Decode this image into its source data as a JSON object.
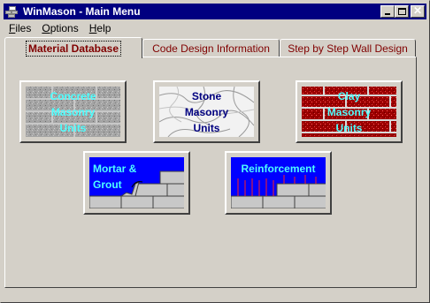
{
  "window": {
    "title": "WinMason - Main Menu"
  },
  "menu": [
    {
      "label": "Files"
    },
    {
      "label": "Options"
    },
    {
      "label": "Help"
    }
  ],
  "tabs": [
    {
      "label": "Material Database",
      "active": true
    },
    {
      "label": "Code Design Information",
      "active": false
    },
    {
      "label": "Step by Step Wall Design",
      "active": false
    }
  ],
  "materials": {
    "concrete": {
      "label": "Concrete\nMasonry\nUnits",
      "color": "#4dffff"
    },
    "stone": {
      "label": "Stone\nMasonry\nUnits",
      "color": "#000080"
    },
    "clay": {
      "label": "Clay\nMasonry\nUnits",
      "color": "#4dffff"
    },
    "mortar": {
      "label": "Mortar &\nGrout",
      "color": "#4dffff"
    },
    "reinforcement": {
      "label": "Reinforcement",
      "color": "#4dffff"
    }
  },
  "colors": {
    "titlebar": "#000080",
    "tab_text": "#800000",
    "concrete": "#a0a0a0",
    "stone": "#f0f0f0",
    "clay": "#a00000",
    "sky": "#0000ff"
  }
}
